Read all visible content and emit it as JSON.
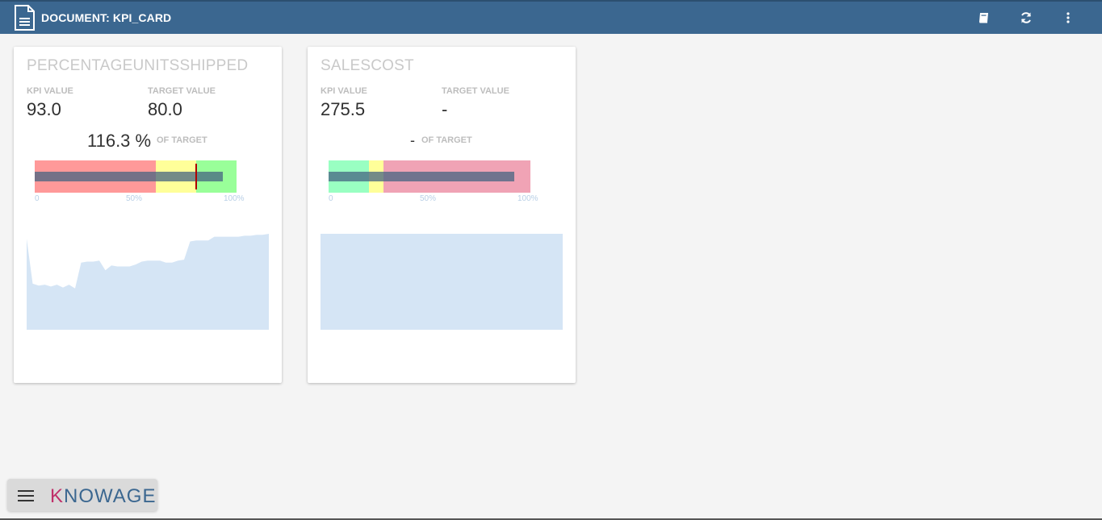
{
  "header": {
    "title": "DOCUMENT: KPI_CARD",
    "actions": [
      {
        "icon": "book-icon"
      },
      {
        "icon": "refresh-icon"
      },
      {
        "icon": "more-vertical-icon"
      }
    ]
  },
  "cards": [
    {
      "title": "PERCENTAGEUNITSSHIPPED",
      "kpi_label": "KPI VALUE",
      "kpi_value": "93.0",
      "target_label": "TARGET VALUE",
      "target_value": "80.0",
      "percent_of_target": "116.3 %",
      "of_target_label": "OF TARGET",
      "gauge": {
        "ranges": [
          {
            "from": 0,
            "to": 60,
            "color": "#ff9999"
          },
          {
            "from": 60,
            "to": 80,
            "color": "#ffff99"
          },
          {
            "from": 80,
            "to": 100,
            "color": "#99ff99"
          }
        ],
        "value_percent": 93,
        "target_percent": 80,
        "ticks": [
          "0",
          "50%",
          "100%"
        ]
      },
      "sparkline": [
        95,
        48,
        46,
        47,
        45,
        47,
        44,
        47,
        43,
        70,
        71,
        71,
        72,
        62,
        67,
        66,
        66,
        66,
        68,
        71,
        72,
        72,
        72,
        70,
        70,
        72,
        73,
        92,
        93,
        93,
        93,
        97,
        97,
        97,
        97,
        97,
        98,
        98,
        99,
        99,
        100
      ]
    },
    {
      "title": "SALESCOST",
      "kpi_label": "KPI VALUE",
      "kpi_value": "275.5",
      "target_label": "TARGET VALUE",
      "target_value": "-",
      "percent_of_target": "-",
      "of_target_label": "OF TARGET",
      "gauge": {
        "ranges": [
          {
            "from": 0,
            "to": 20,
            "color": "#99ffc2"
          },
          {
            "from": 20,
            "to": 27,
            "color": "#ffff99"
          },
          {
            "from": 27,
            "to": 100,
            "color": "#f0a3b5"
          }
        ],
        "value_percent": 92,
        "ticks": [
          "0",
          "50%",
          "100%"
        ]
      },
      "sparkline": [
        100,
        100
      ]
    }
  ],
  "footer": {
    "logo": "KNOWAGE",
    "menu_icon": "hamburger-menu-icon"
  }
}
